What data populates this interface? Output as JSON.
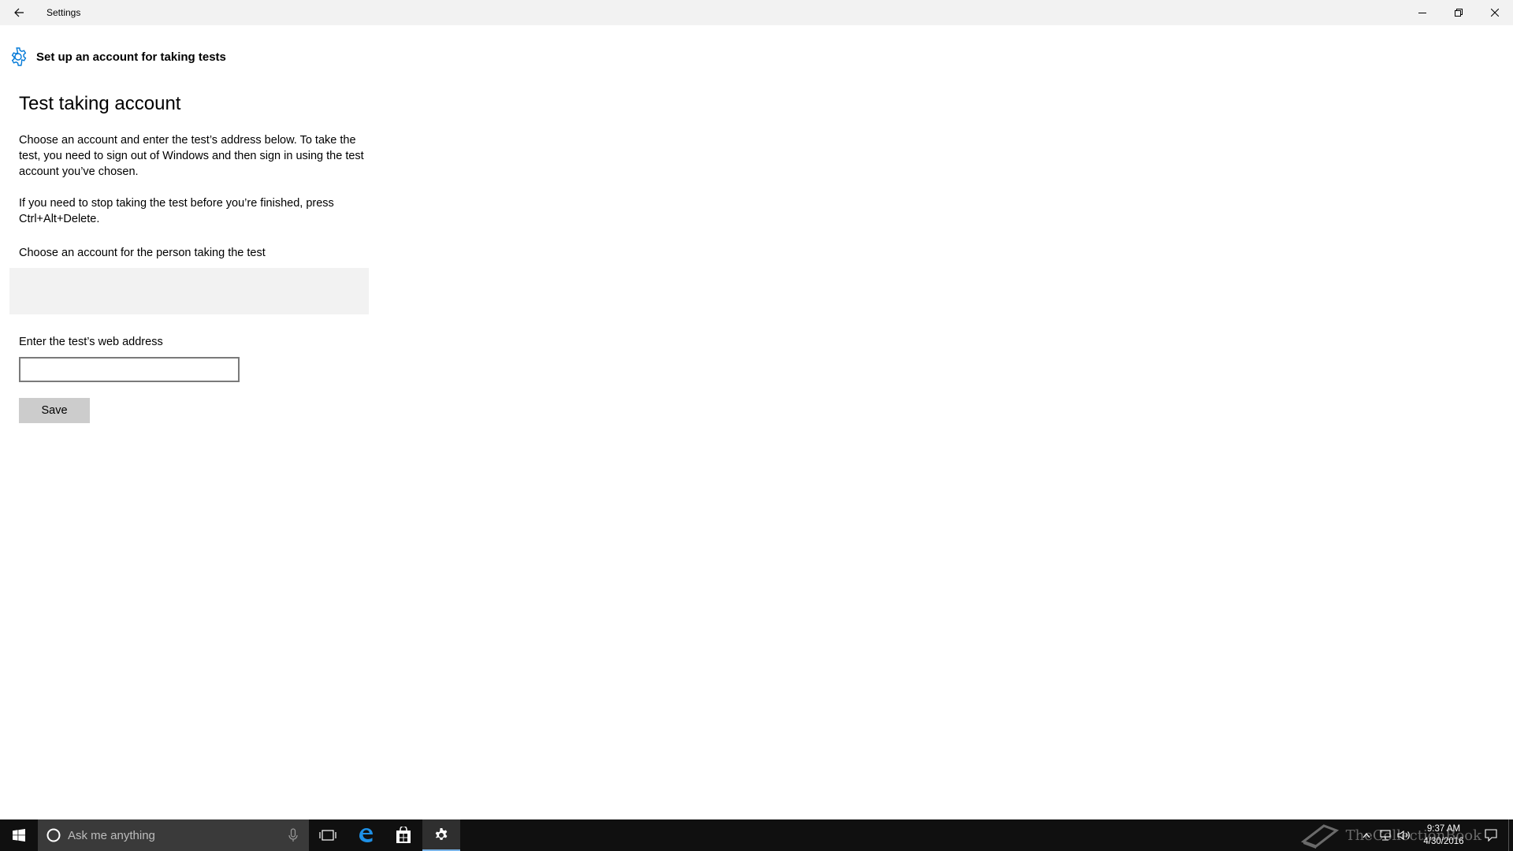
{
  "window": {
    "title": "Settings",
    "controls": [
      "minimize-icon",
      "restore-icon",
      "close-icon"
    ]
  },
  "page": {
    "header": "Set up an account for taking tests",
    "header_icon": "gear-icon",
    "section_title": "Test taking account",
    "paragraph1": "Choose an account and enter the test’s address below. To take the test, you need to sign out of Windows and then sign in using the test account you’ve chosen.",
    "paragraph2": "If you need to stop taking the test before you’re finished, press Ctrl+Alt+Delete.",
    "account_label": "Choose an account for the person taking the test",
    "web_label": "Enter the test’s web address",
    "web_value": "",
    "save_label": "Save"
  },
  "taskbar": {
    "search_placeholder": "Ask me anything",
    "pinned": [
      "task-view-icon",
      "edge-icon",
      "store-icon",
      "settings-icon"
    ],
    "active_app": "settings-icon",
    "clock_time": "9:37 AM",
    "clock_date": "4/30/2016",
    "watermark": "TheCollectionBook"
  },
  "colors": {
    "accent": "#0078d7",
    "titlebar": "#f2f2f2",
    "taskbar": "#101010",
    "button": "#cccccc"
  }
}
